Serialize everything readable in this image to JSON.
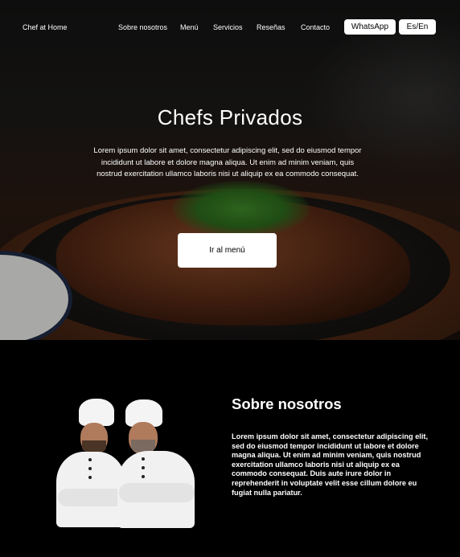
{
  "nav": {
    "brand": "Chef at Home",
    "items": [
      "Sobre nosotros",
      "Menú",
      "Servicios",
      "Reseñas",
      "Contacto"
    ],
    "whatsapp_label": "WhatsApp",
    "language_label": "Es/En"
  },
  "hero": {
    "title": "Chefs Privados",
    "text": "Lorem ipsum dolor sit amet, consectetur adipiscing elit, sed do eiusmod tempor incididunt ut labore et dolore magna aliqua. Ut enim ad minim veniam, quis nostrud exercitation ullamco laboris nisi ut aliquip ex ea commodo consequat.",
    "cta_label": "Ir al menú"
  },
  "about": {
    "title": "Sobre nosotros",
    "text": "Lorem ipsum dolor sit amet, consectetur adipiscing elit, sed do eiusmod tempor incididunt ut labore et dolore magna aliqua. Ut enim ad minim veniam, quis nostrud exercitation ullamco laboris nisi ut aliquip ex ea commodo consequat. Duis aute irure dolor in reprehenderit in voluptate velit esse cillum dolore eu fugiat nulla pariatur."
  },
  "colors": {
    "background": "#000000",
    "text": "#ffffff",
    "button_bg": "#ffffff",
    "button_text": "#000000"
  }
}
